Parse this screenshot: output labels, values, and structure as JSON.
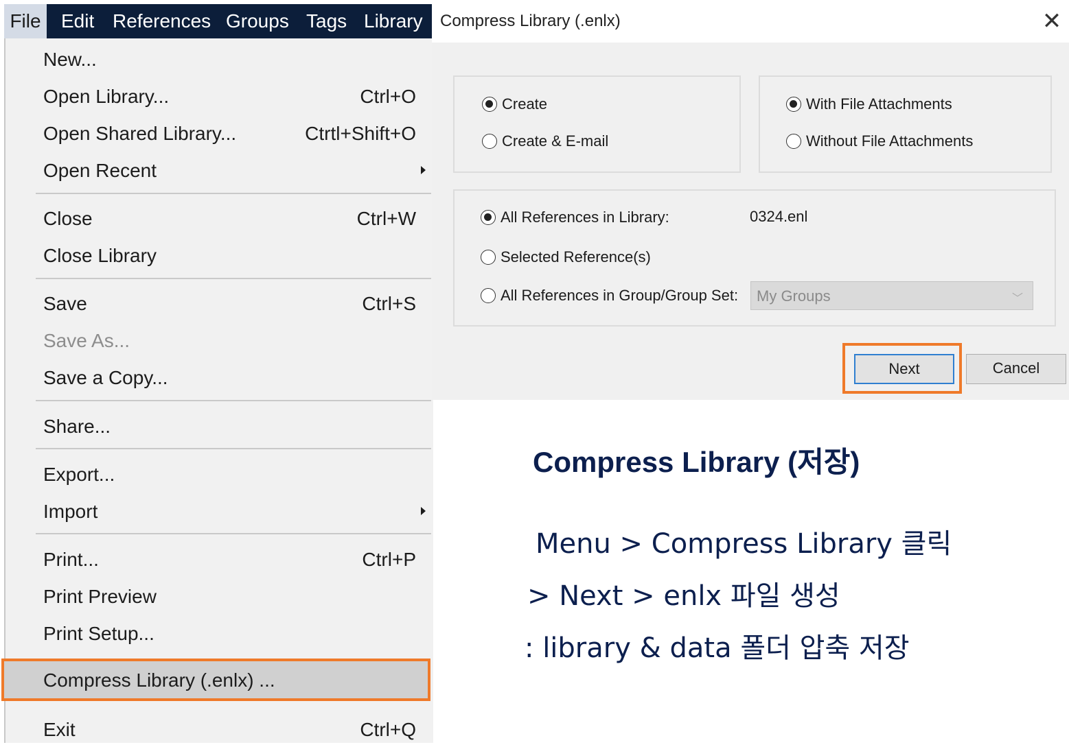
{
  "menubar": {
    "items": [
      "File",
      "Edit",
      "References",
      "Groups",
      "Tags",
      "Library"
    ]
  },
  "file_menu": {
    "items": [
      {
        "label": "New...",
        "shortcut": ""
      },
      {
        "label": "Open Library...",
        "shortcut": "Ctrl+O"
      },
      {
        "label": "Open Shared Library...",
        "shortcut": "Ctrtl+Shift+O"
      },
      {
        "label": "Open Recent",
        "shortcut": ""
      },
      {
        "label": "Close",
        "shortcut": "Ctrl+W"
      },
      {
        "label": "Close Library",
        "shortcut": ""
      },
      {
        "label": "Save",
        "shortcut": "Ctrl+S"
      },
      {
        "label": "Save As...",
        "shortcut": ""
      },
      {
        "label": "Save a Copy...",
        "shortcut": ""
      },
      {
        "label": "Share...",
        "shortcut": ""
      },
      {
        "label": "Export...",
        "shortcut": ""
      },
      {
        "label": "Import",
        "shortcut": ""
      },
      {
        "label": "Print...",
        "shortcut": "Ctrl+P"
      },
      {
        "label": "Print Preview",
        "shortcut": ""
      },
      {
        "label": "Print Setup...",
        "shortcut": ""
      },
      {
        "label": "Compress Library (.enlx) ...",
        "shortcut": ""
      },
      {
        "label": "Exit",
        "shortcut": "Ctrl+Q"
      }
    ]
  },
  "dialog": {
    "title": "Compress Library (.enlx)",
    "close_glyph": "✕",
    "create_options": [
      "Create",
      "Create & E-mail"
    ],
    "attachment_options": [
      "With File Attachments",
      "Without File Attachments"
    ],
    "reference_options": [
      "All References in Library:",
      "Selected Reference(s)",
      "All References in Group/Group Set:"
    ],
    "library_name": "0324.enl",
    "group_select_value": "My Groups",
    "next_label": "Next",
    "cancel_label": "Cancel"
  },
  "caption": {
    "title": "Compress Library (저장)",
    "line1": "Menu > Compress Library 클릭",
    "line2": "> Next > enlx 파일 생성",
    "line3": ": library & data 폴더 압축 저장"
  },
  "colors": {
    "menubar_bg": "#0c1e3a",
    "highlight_orange": "#ef7a2a",
    "caption_navy": "#0c1f4e",
    "focus_blue": "#2f7fd0"
  }
}
